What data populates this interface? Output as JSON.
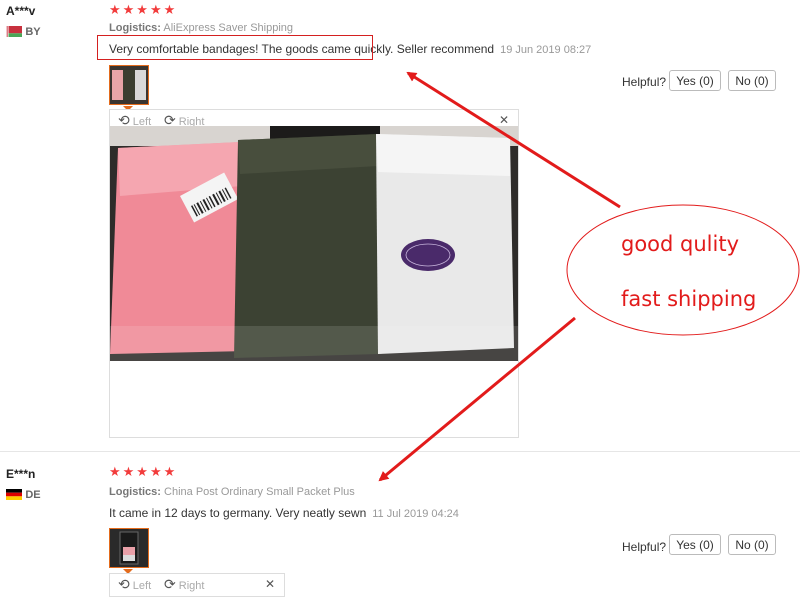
{
  "reviews": [
    {
      "user": "A***v",
      "country": "BY",
      "stars": "★★★★★",
      "logistics_label": "Logistics:",
      "logistics": "AliExpress Saver Shipping",
      "text": "Very comfortable bandages! The goods came quickly. Seller recommend",
      "date": "19 Jun 2019 08:27",
      "helpful_label": "Helpful?",
      "yes": "Yes (0)",
      "no": "No (0)",
      "rotate_left": "Left",
      "rotate_right": "Right",
      "close": "✕"
    },
    {
      "user": "E***n",
      "country": "DE",
      "stars": "★★★★★",
      "logistics_label": "Logistics:",
      "logistics": "China Post Ordinary Small Packet Plus",
      "text": "It came in 12 days to germany. Very neatly sewn",
      "date": "11 Jul 2019 04:24",
      "helpful_label": "Helpful?",
      "yes": "Yes (0)",
      "no": "No (0)",
      "rotate_left": "Left",
      "rotate_right": "Right",
      "close": "✕"
    }
  ],
  "annotation": {
    "line1": "good qulity",
    "line2": "fast shipping"
  },
  "colors": {
    "stars": "#f23c3c",
    "annotation": "#e21b1b",
    "thumb_border": "#e36b1c"
  },
  "flags": {
    "BY": [
      "#c8313e",
      "#4aa657"
    ],
    "DE": [
      "#000000",
      "#dd0000",
      "#ffce00"
    ]
  }
}
